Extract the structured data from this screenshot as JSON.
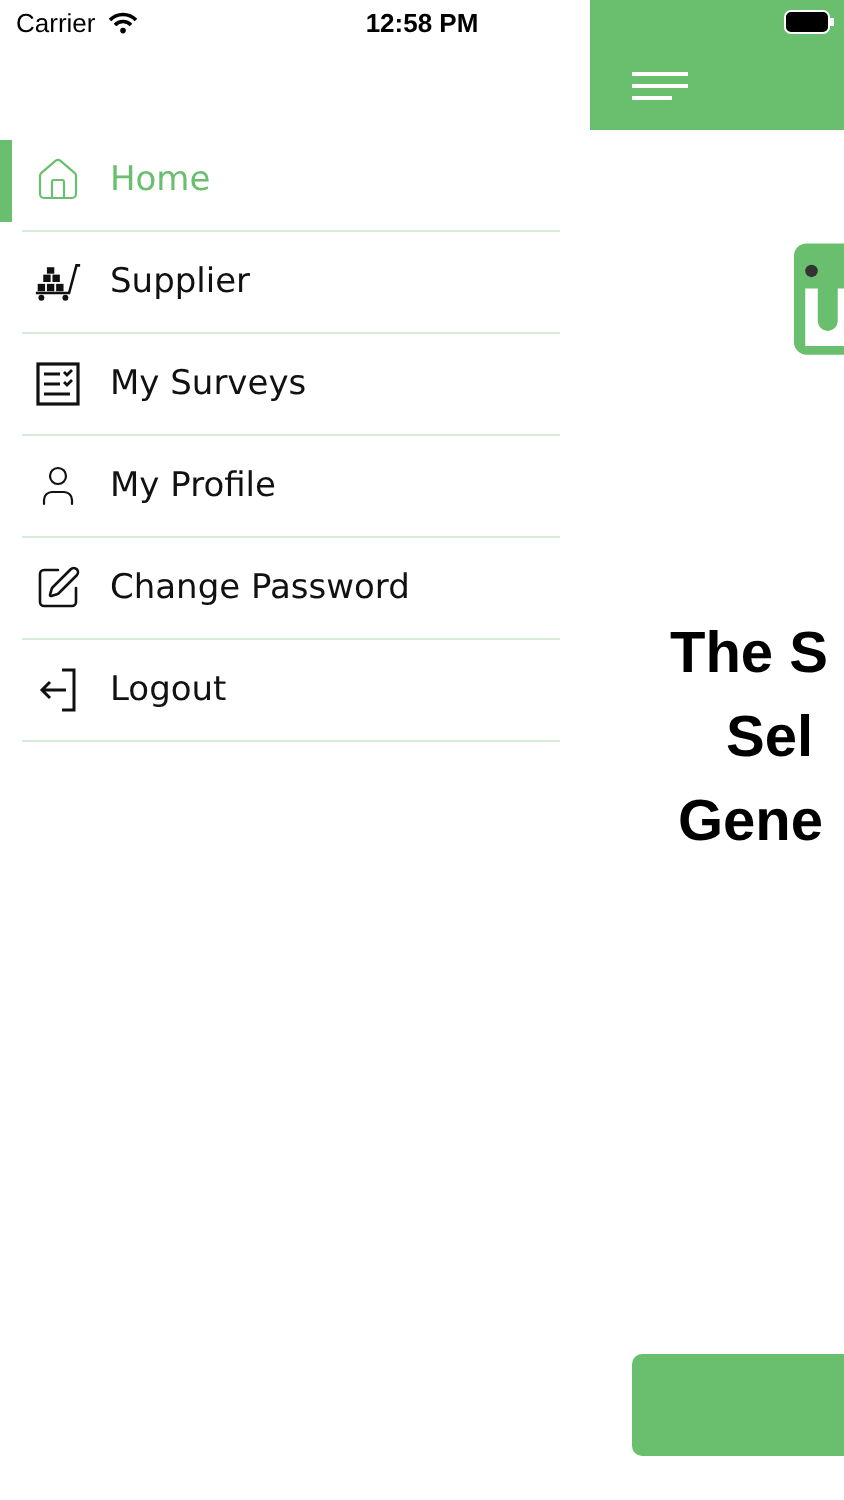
{
  "status_bar": {
    "carrier": "Carrier",
    "time": "12:58 PM"
  },
  "drawer": {
    "items": [
      {
        "label": "Home",
        "selected": true
      },
      {
        "label": "Supplier",
        "selected": false
      },
      {
        "label": "My Surveys",
        "selected": false
      },
      {
        "label": "My Profile",
        "selected": false
      },
      {
        "label": "Change Password",
        "selected": false
      },
      {
        "label": "Logout",
        "selected": false
      }
    ]
  },
  "main": {
    "heading_lines": [
      "The S",
      "Sel",
      "Gene"
    ]
  }
}
